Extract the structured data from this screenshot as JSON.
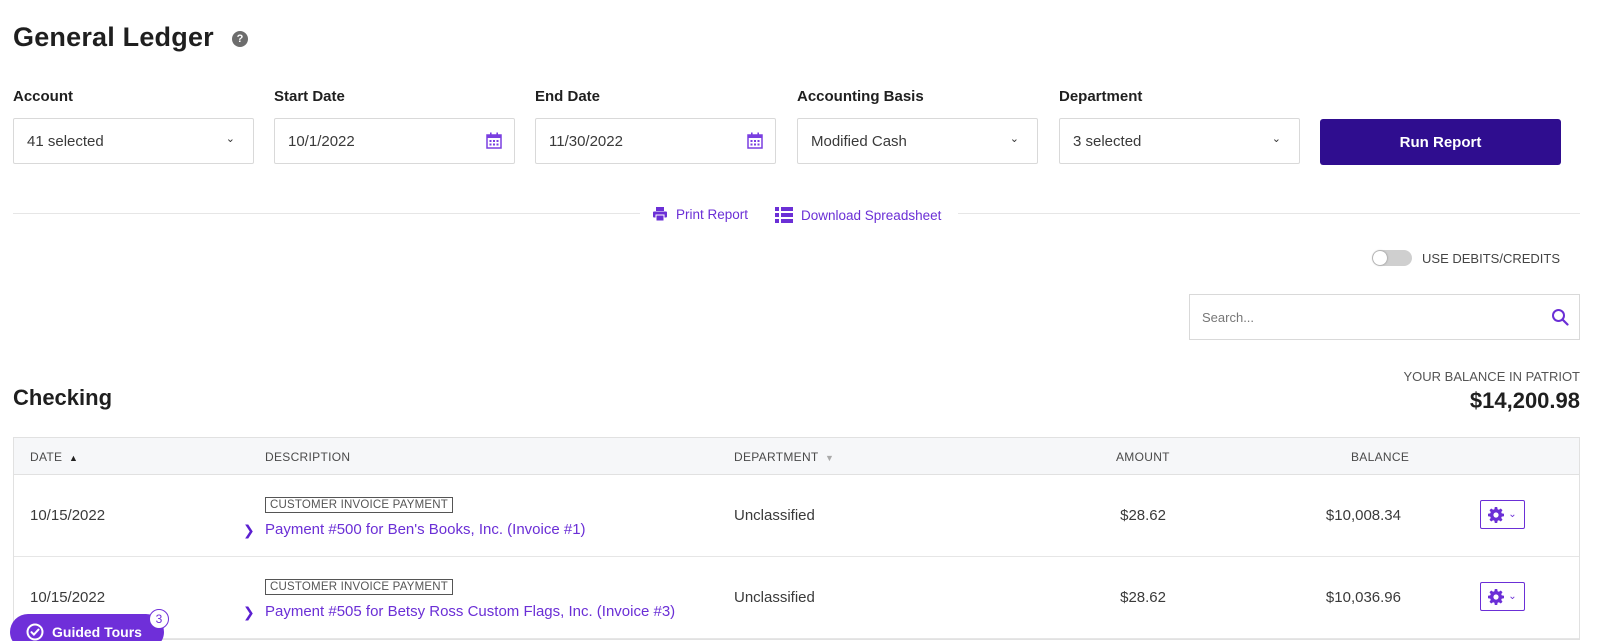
{
  "header": {
    "title": "General Ledger",
    "help_glyph": "?"
  },
  "filters": {
    "account": {
      "label": "Account",
      "value": "41 selected"
    },
    "start_date": {
      "label": "Start Date",
      "value": "10/1/2022"
    },
    "end_date": {
      "label": "End Date",
      "value": "11/30/2022"
    },
    "basis": {
      "label": "Accounting Basis",
      "value": "Modified Cash"
    },
    "department": {
      "label": "Department",
      "value": "3 selected"
    },
    "run_label": "Run Report"
  },
  "actions": {
    "print": "Print Report",
    "download": "Download Spreadsheet"
  },
  "toggle": {
    "label": "USE DEBITS/CREDITS",
    "on": false
  },
  "search": {
    "placeholder": "Search..."
  },
  "section": {
    "title": "Checking",
    "balance_label": "YOUR BALANCE IN PATRIOT",
    "balance_value": "$14,200.98"
  },
  "table": {
    "headers": {
      "date": "DATE",
      "description": "DESCRIPTION",
      "department": "DEPARTMENT",
      "amount": "AMOUNT",
      "balance": "BALANCE"
    },
    "rows": [
      {
        "date": "10/15/2022",
        "tag": "CUSTOMER INVOICE PAYMENT",
        "description": "Payment #500 for Ben's Books, Inc. (Invoice #1)",
        "department": "Unclassified",
        "amount": "$28.62",
        "balance": "$10,008.34"
      },
      {
        "date": "10/15/2022",
        "tag": "CUSTOMER INVOICE PAYMENT",
        "description": "Payment #505 for Betsy Ross Custom Flags, Inc. (Invoice #3)",
        "department": "Unclassified",
        "amount": "$28.62",
        "balance": "$10,036.96"
      }
    ]
  },
  "tours": {
    "label": "Guided Tours",
    "count": "3"
  },
  "colors": {
    "primary": "#2f0d8f",
    "accent": "#6b2fd6",
    "tours": "#6f2fd9"
  }
}
